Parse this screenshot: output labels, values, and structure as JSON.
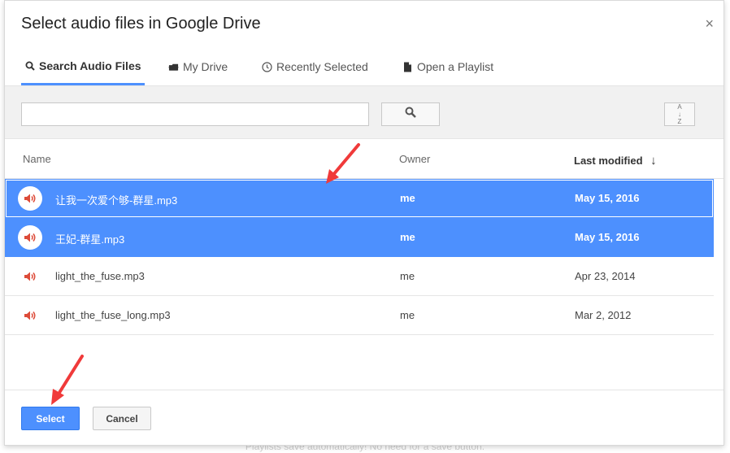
{
  "footnote": "Playlists save automatically! No need for a save button.",
  "dialog": {
    "title": "Select audio files in Google Drive",
    "close_glyph": "×"
  },
  "tabs": [
    {
      "label": "Search Audio Files",
      "icon": "search-icon",
      "active": true
    },
    {
      "label": "My Drive",
      "icon": "drive-icon",
      "active": false
    },
    {
      "label": "Recently Selected",
      "icon": "clock-icon",
      "active": false
    },
    {
      "label": "Open a Playlist",
      "icon": "document-icon",
      "active": false
    }
  ],
  "search": {
    "value": "",
    "sort_glyph": "A↓Z"
  },
  "table": {
    "columns": {
      "name": "Name",
      "owner": "Owner",
      "modified": "Last modified",
      "sort_arrow": "↓"
    },
    "rows": [
      {
        "name": "让我一次爱个够-群星.mp3",
        "owner": "me",
        "date": "May 15, 2016",
        "selected": true
      },
      {
        "name": "王妃-群星.mp3",
        "owner": "me",
        "date": "May 15, 2016",
        "selected": true
      },
      {
        "name": "light_the_fuse.mp3",
        "owner": "me",
        "date": "Apr 23, 2014",
        "selected": false
      },
      {
        "name": "light_the_fuse_long.mp3",
        "owner": "me",
        "date": "Mar 2, 2012",
        "selected": false
      }
    ]
  },
  "footer": {
    "select_label": "Select",
    "cancel_label": "Cancel"
  },
  "colors": {
    "accent": "#4d90fe",
    "speaker_icon": "#dd4b39",
    "annotation_arrow": "#f03a3a"
  }
}
